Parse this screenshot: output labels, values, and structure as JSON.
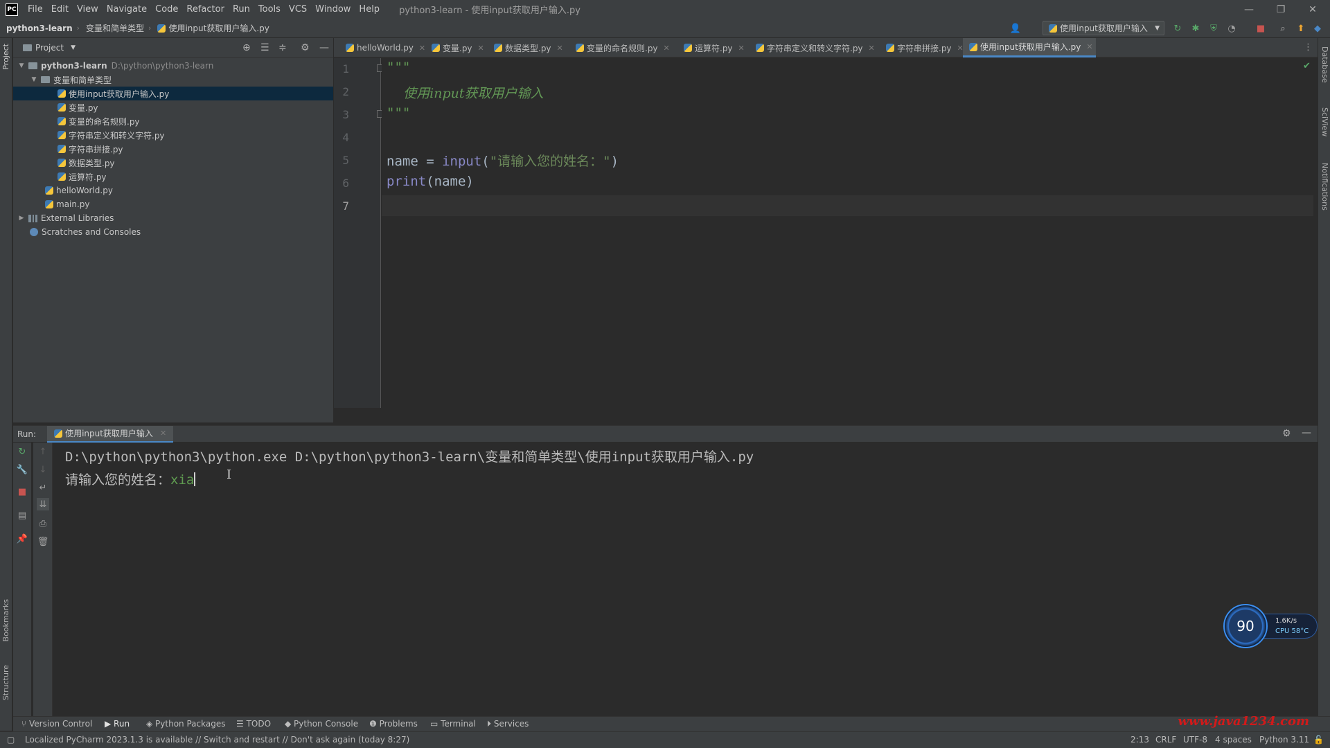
{
  "titlebar": {
    "logo": "PC",
    "menu": [
      "File",
      "Edit",
      "View",
      "Navigate",
      "Code",
      "Refactor",
      "Run",
      "Tools",
      "VCS",
      "Window",
      "Help"
    ],
    "window_title": "python3-learn - 使用input获取用户输入.py",
    "minimize": "—",
    "restore": "❐",
    "close": "✕"
  },
  "navbar": {
    "project": "python3-learn",
    "folder": "变量和简单类型",
    "file": "使用input获取用户输入.py",
    "run_config": "使用input获取用户输入"
  },
  "left_strip": {
    "project": "Project",
    "bookmarks": "Bookmarks",
    "structure": "Structure"
  },
  "right_strip": {
    "database": "Database",
    "sciview": "SciView",
    "notifications": "Notifications"
  },
  "project_panel": {
    "title": "Project",
    "tree": {
      "root": {
        "name": "python3-learn",
        "path": "D:\\python\\python3-learn"
      },
      "folder": "变量和简单类型",
      "folder_files": [
        "使用input获取用户输入.py",
        "变量.py",
        "变量的命名规则.py",
        "字符串定义和转义字符.py",
        "字符串拼接.py",
        "数据类型.py",
        "运算符.py"
      ],
      "root_files": [
        "helloWorld.py",
        "main.py"
      ],
      "external_libraries": "External Libraries",
      "scratches": "Scratches and Consoles"
    }
  },
  "editor_tabs": [
    "helloWorld.py",
    "变量.py",
    "数据类型.py",
    "变量的命名规则.py",
    "运算符.py",
    "字符串定义和转义字符.py",
    "字符串拼接.py",
    "使用input获取用户输入.py"
  ],
  "editor": {
    "line_numbers": [
      "1",
      "2",
      "3",
      "4",
      "5",
      "6",
      "7"
    ],
    "lines": {
      "l1": "\"\"\"",
      "l2": "    使用input获取用户输入",
      "l3": "\"\"\"",
      "l5_var": "name = ",
      "l5_fn": "input",
      "l5_open": "(",
      "l5_str": "\"请输入您的姓名：\"",
      "l5_close": ")",
      "l6_fn": "print",
      "l6_rest": "(name)"
    }
  },
  "run_panel": {
    "label": "Run:",
    "tab": "使用input获取用户输入",
    "console": {
      "command": "D:\\python\\python3\\python.exe D:\\python\\python3-learn\\变量和简单类型\\使用input获取用户输入.py",
      "prompt": "请输入您的姓名：",
      "user_input": "xia"
    }
  },
  "perf_widget": {
    "score": "90",
    "net": "1.6K/s",
    "cpu": "CPU 58°C"
  },
  "bottom_tools": {
    "version_control": "Version Control",
    "run": "Run",
    "python_packages": "Python Packages",
    "todo": "TODO",
    "python_console": "Python Console",
    "problems": "Problems",
    "terminal": "Terminal",
    "services": "Services",
    "watermark": "www.java1234.com"
  },
  "statusbar": {
    "message": "Localized PyCharm 2023.1.3 is available // Switch and restart // Don't ask again (today 8:27)",
    "position": "2:13",
    "line_sep": "CRLF",
    "encoding": "UTF-8",
    "indent": "4 spaces",
    "interpreter": "Python 3.11"
  }
}
